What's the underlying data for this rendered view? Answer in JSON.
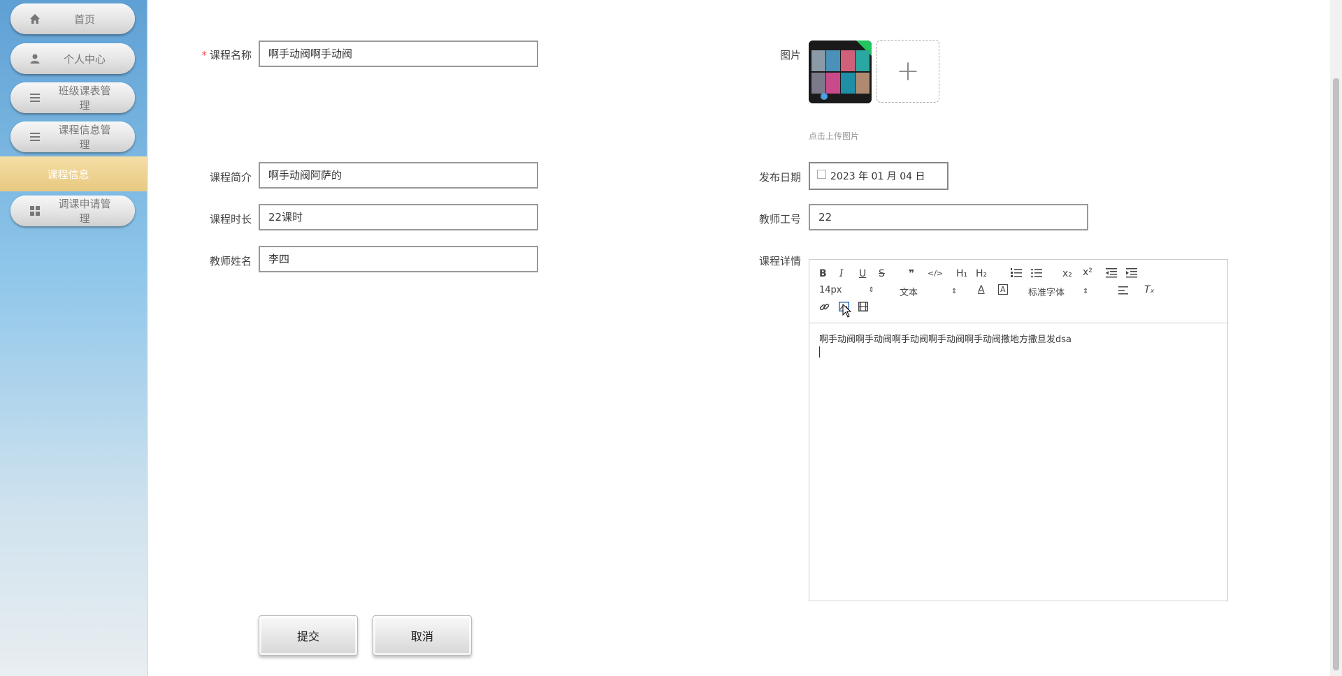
{
  "sidebar": {
    "items": [
      {
        "label": "首页",
        "icon": "home-icon"
      },
      {
        "label": "个人中心",
        "icon": "user-icon"
      },
      {
        "label": "班级课表管理",
        "icon": "list-icon"
      },
      {
        "label": "课程信息管理",
        "icon": "list-icon"
      },
      {
        "label": "课程信息",
        "active": true
      },
      {
        "label": "调课申请管理",
        "icon": "grid-icon"
      }
    ]
  },
  "form": {
    "course_name": {
      "label": "课程名称",
      "required_mark": "*",
      "value": "啊手动阀啊手动阀"
    },
    "image": {
      "label": "图片",
      "upload_hint": "点击上传图片",
      "add_symbol": "+"
    },
    "intro": {
      "label": "课程简介",
      "value": "啊手动阀阿萨的"
    },
    "publish_date": {
      "label": "发布日期",
      "value": "2023 年 01 月 04 日"
    },
    "duration": {
      "label": "课程时长",
      "value": "22课时"
    },
    "teacher_id": {
      "label": "教师工号",
      "value": "22"
    },
    "teacher_name": {
      "label": "教师姓名",
      "value": "李四"
    },
    "details": {
      "label": "课程详情",
      "font_size": "14px",
      "text_type": "文本",
      "font_family": "标准字体",
      "content": "啊手动阀啊手动阀啊手动阀啊手动阀啊手动阀撒地方撒旦发dsa"
    }
  },
  "buttons": {
    "submit": "提交",
    "cancel": "取消"
  },
  "toolbar_glyphs": {
    "bold": "B",
    "italic": "I",
    "underline": "U",
    "strike": "S",
    "quote": "❞",
    "code": "</>",
    "h1": "H₁",
    "h2": "H₂",
    "sub": "x₂",
    "sup": "x²",
    "clear": "Tₓ",
    "color": "A"
  },
  "colors": {
    "accent_active": "#e8c880",
    "sidebar_top": "#5fa0d4"
  }
}
